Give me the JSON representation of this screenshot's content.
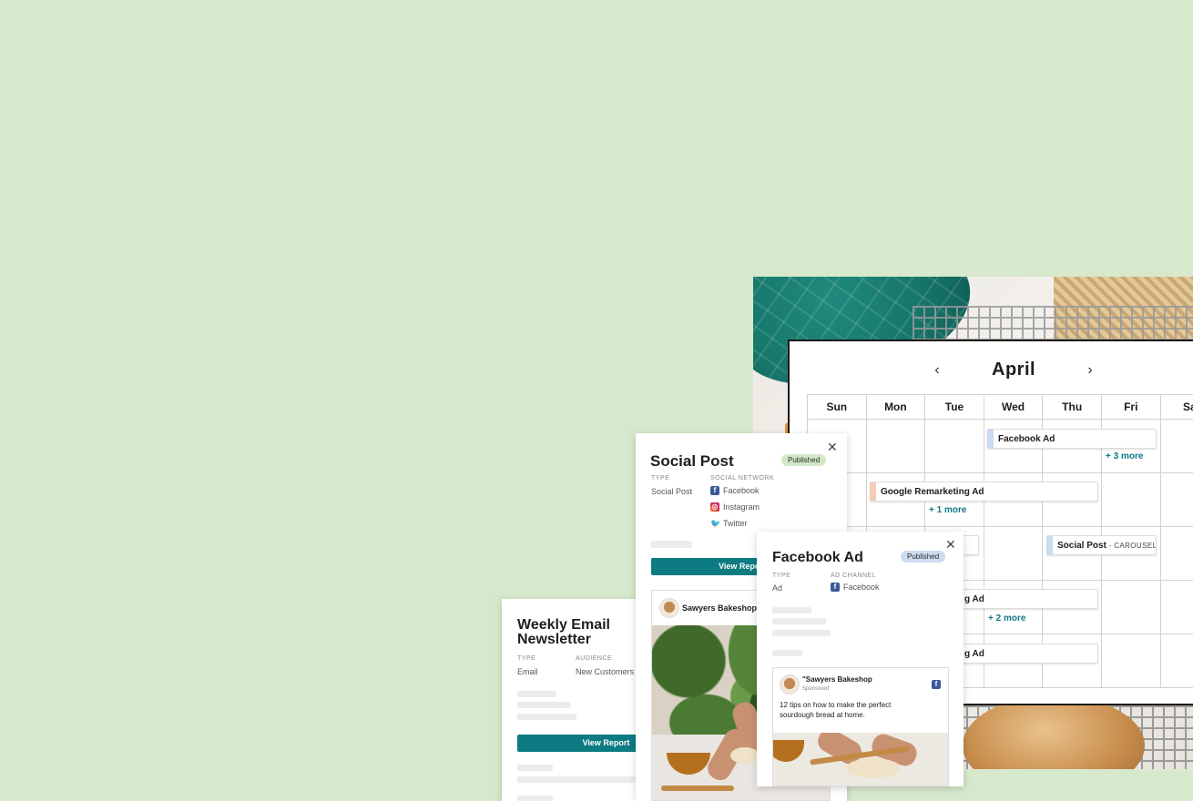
{
  "calendar": {
    "month": "April",
    "prev_icon": "‹",
    "next_icon": "›",
    "days": [
      "Sun",
      "Mon",
      "Tue",
      "Wed",
      "Thu",
      "Fri",
      "Sa"
    ],
    "events": [
      {
        "title": "Facebook Ad",
        "sub": "",
        "color": "#c9dbef"
      },
      {
        "title": "Google Remarketing Ad",
        "sub": "",
        "color": "#f5cdb4"
      },
      {
        "title": "Social Post",
        "sub": " - CAROUSEL",
        "color": "#c9dbef"
      },
      {
        "title": "EL",
        "sub": "",
        "color": "#c9dbef"
      },
      {
        "title": "g Ad",
        "sub": "",
        "color": "#c9dbef"
      },
      {
        "title": "g Ad",
        "sub": "",
        "color": "#c9dbef"
      }
    ],
    "more": [
      "+ 3 more",
      "+ 1 more",
      "+ 2 more"
    ]
  },
  "social_post": {
    "title": "Social Post",
    "status": "Published",
    "status_color": "#d3e8c9",
    "type_label": "TYPE",
    "type_value": "Social Post",
    "network_label": "SOCIAL NETWORK",
    "networks": [
      {
        "name": "Facebook",
        "icon": "facebook-icon"
      },
      {
        "name": "Instagram",
        "icon": "instagram-icon"
      },
      {
        "name": "Twitter",
        "icon": "twitter-icon"
      }
    ],
    "button": "View Report",
    "account": "Sawyers Bakeshop"
  },
  "facebook_ad": {
    "title": "Facebook Ad",
    "status": "Published",
    "status_color": "#cddcee",
    "type_label": "TYPE",
    "type_value": "Ad",
    "channel_label": "AD CHANNEL",
    "channel_value": "Facebook",
    "account": "\"Sawyers Bakeshop",
    "sponsored": "Sponsored",
    "post_text": "12 tips on how to make the perfect sourdough bread at home."
  },
  "newsletter": {
    "title": "Weekly Email Newsletter",
    "type_label": "TYPE",
    "type_value": "Email",
    "audience_label": "AUDIENCE",
    "audience_value": "New Customers",
    "button": "View Report"
  },
  "colors": {
    "accent": "#0d7b82",
    "background": "#d7e9cc"
  }
}
